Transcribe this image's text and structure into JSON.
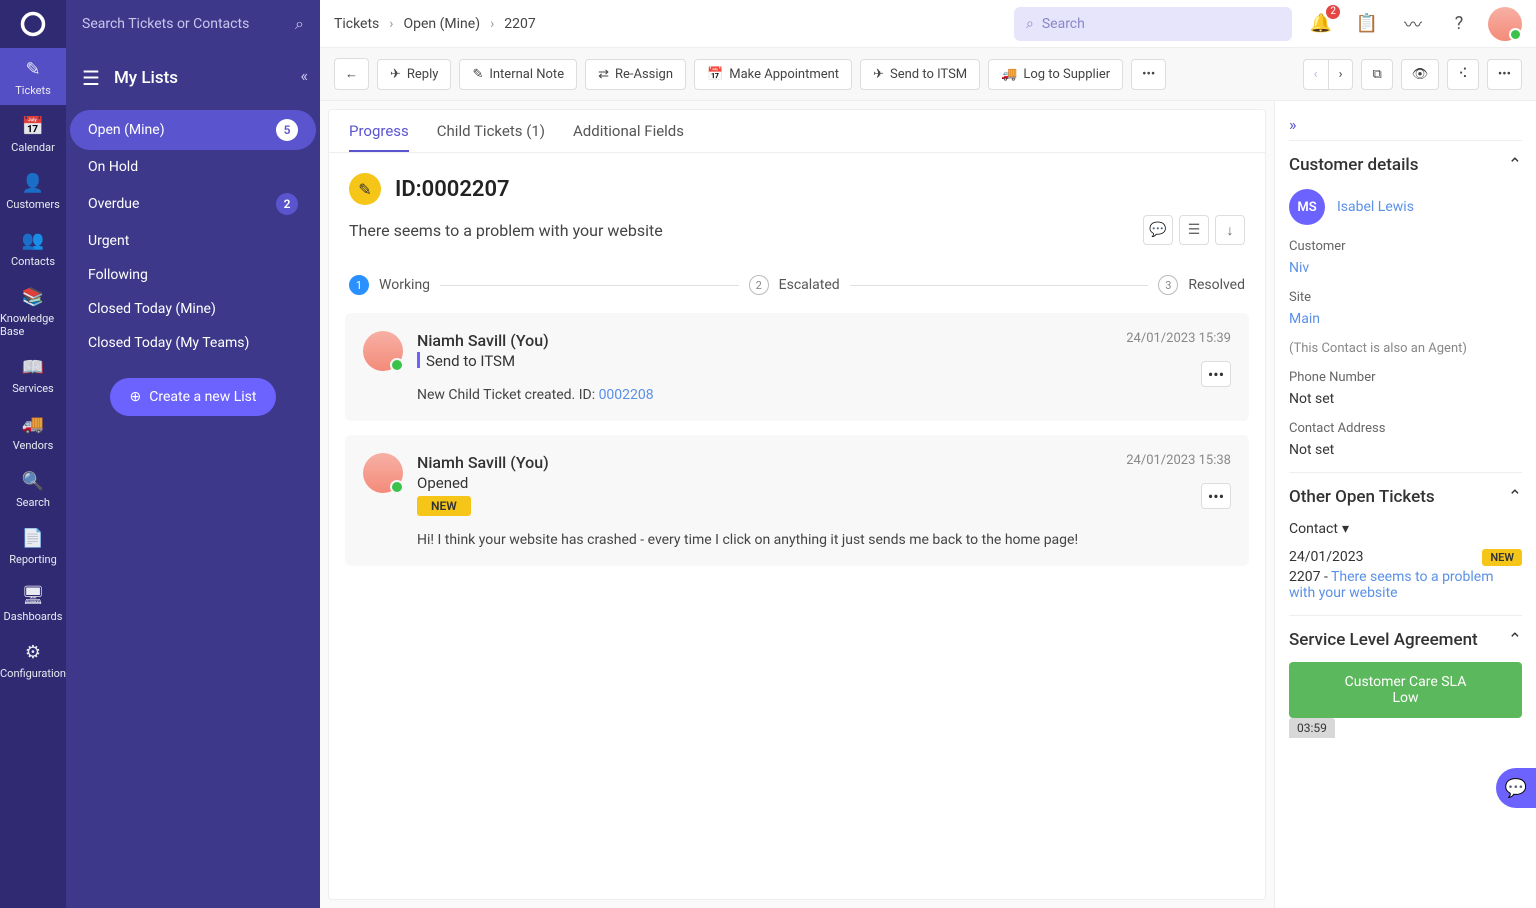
{
  "search_global_placeholder": "Search Tickets or Contacts",
  "nav": [
    {
      "label": "Tickets",
      "icon": "✎"
    },
    {
      "label": "Calendar",
      "icon": "📅"
    },
    {
      "label": "Customers",
      "icon": "👤"
    },
    {
      "label": "Contacts",
      "icon": "👥"
    },
    {
      "label": "Knowledge Base",
      "icon": "📚"
    },
    {
      "label": "Services",
      "icon": "📖"
    },
    {
      "label": "Vendors",
      "icon": "🚚"
    },
    {
      "label": "Search",
      "icon": "🔍"
    },
    {
      "label": "Reporting",
      "icon": "📄"
    },
    {
      "label": "Dashboards",
      "icon": "🖥"
    },
    {
      "label": "Configuration",
      "icon": "⚙"
    }
  ],
  "my_lists_title": "My Lists",
  "lists": [
    {
      "label": "Open (Mine)",
      "count": "5",
      "active": true
    },
    {
      "label": "On Hold"
    },
    {
      "label": "Overdue",
      "count": "2"
    },
    {
      "label": "Urgent"
    },
    {
      "label": "Following"
    },
    {
      "label": "Closed Today (Mine)"
    },
    {
      "label": "Closed Today (My Teams)"
    }
  ],
  "create_list_label": "Create a new List",
  "breadcrumb": [
    "Tickets",
    "Open (Mine)",
    "2207"
  ],
  "top_search_placeholder": "Search",
  "notif_count": "2",
  "actions": {
    "back": "←",
    "reply": "Reply",
    "internal": "Internal Note",
    "reassign": "Re-Assign",
    "appointment": "Make Appointment",
    "itsm": "Send to ITSM",
    "supplier": "Log to Supplier"
  },
  "tabs": {
    "progress": "Progress",
    "child": "Child Tickets (1)",
    "additional": "Additional Fields"
  },
  "ticket": {
    "id_label": "ID:0002207",
    "title": "There seems to a problem with your website",
    "steps": [
      "Working",
      "Escalated",
      "Resolved"
    ]
  },
  "thread": [
    {
      "author": "Niamh Savill (You)",
      "action": "Send to ITSM",
      "action_bar": true,
      "ts": "24/01/2023 15:39",
      "body_prefix": "New Child Ticket created. ID: ",
      "body_link": "0002208"
    },
    {
      "author": "Niamh Savill (You)",
      "action": "Opened",
      "tag": "NEW",
      "ts": "24/01/2023 15:38",
      "body": "Hi! I think your website has crashed - every time I click on anything it just sends me back to the home page!"
    }
  ],
  "side": {
    "cust_title": "Customer details",
    "avatar": "MS",
    "name": "Isabel Lewis",
    "customer_label": "Customer",
    "customer": "Niv",
    "site_label": "Site",
    "site": "Main",
    "note": "(This Contact is also an Agent)",
    "phone_label": "Phone Number",
    "phone": "Not set",
    "addr_label": "Contact Address",
    "addr": "Not set",
    "other_title": "Other Open Tickets",
    "contact_drop": "Contact",
    "ot_date": "24/01/2023",
    "ot_new": "NEW",
    "ot_id": "2207",
    "ot_sep": " - ",
    "ot_link": "There seems to a problem with your website",
    "sla_title": "Service Level Agreement",
    "sla_name": "Customer Care SLA",
    "sla_level": "Low",
    "sla_time": "03:59"
  }
}
